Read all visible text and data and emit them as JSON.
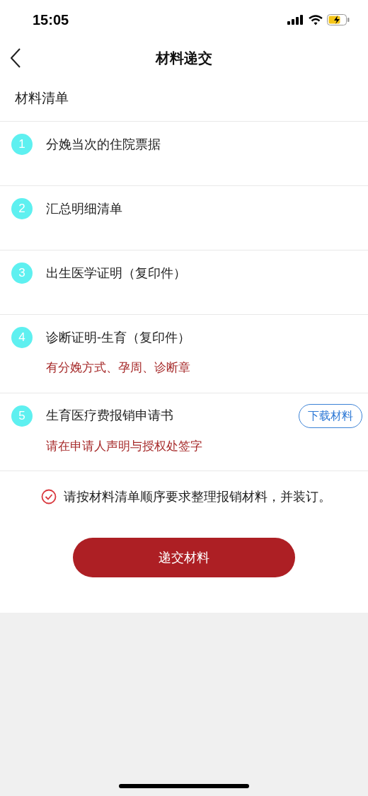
{
  "status_bar": {
    "time": "15:05"
  },
  "nav": {
    "title": "材料递交"
  },
  "section_title": "材料清单",
  "items": [
    {
      "number": "1",
      "name": "分娩当次的住院票据"
    },
    {
      "number": "2",
      "name": "汇总明细清单"
    },
    {
      "number": "3",
      "name": "出生医学证明（复印件）"
    },
    {
      "number": "4",
      "name": "诊断证明-生育（复印件）",
      "note": "有分娩方式、孕周、诊断章"
    },
    {
      "number": "5",
      "name": "生育医疗费报销申请书",
      "note": "请在申请人声明与授权处签字",
      "action": "下载材料"
    }
  ],
  "confirmation": {
    "checked": true,
    "text": "请按材料清单顺序要求整理报销材料，并装订。"
  },
  "submit_button": "递交材料"
}
